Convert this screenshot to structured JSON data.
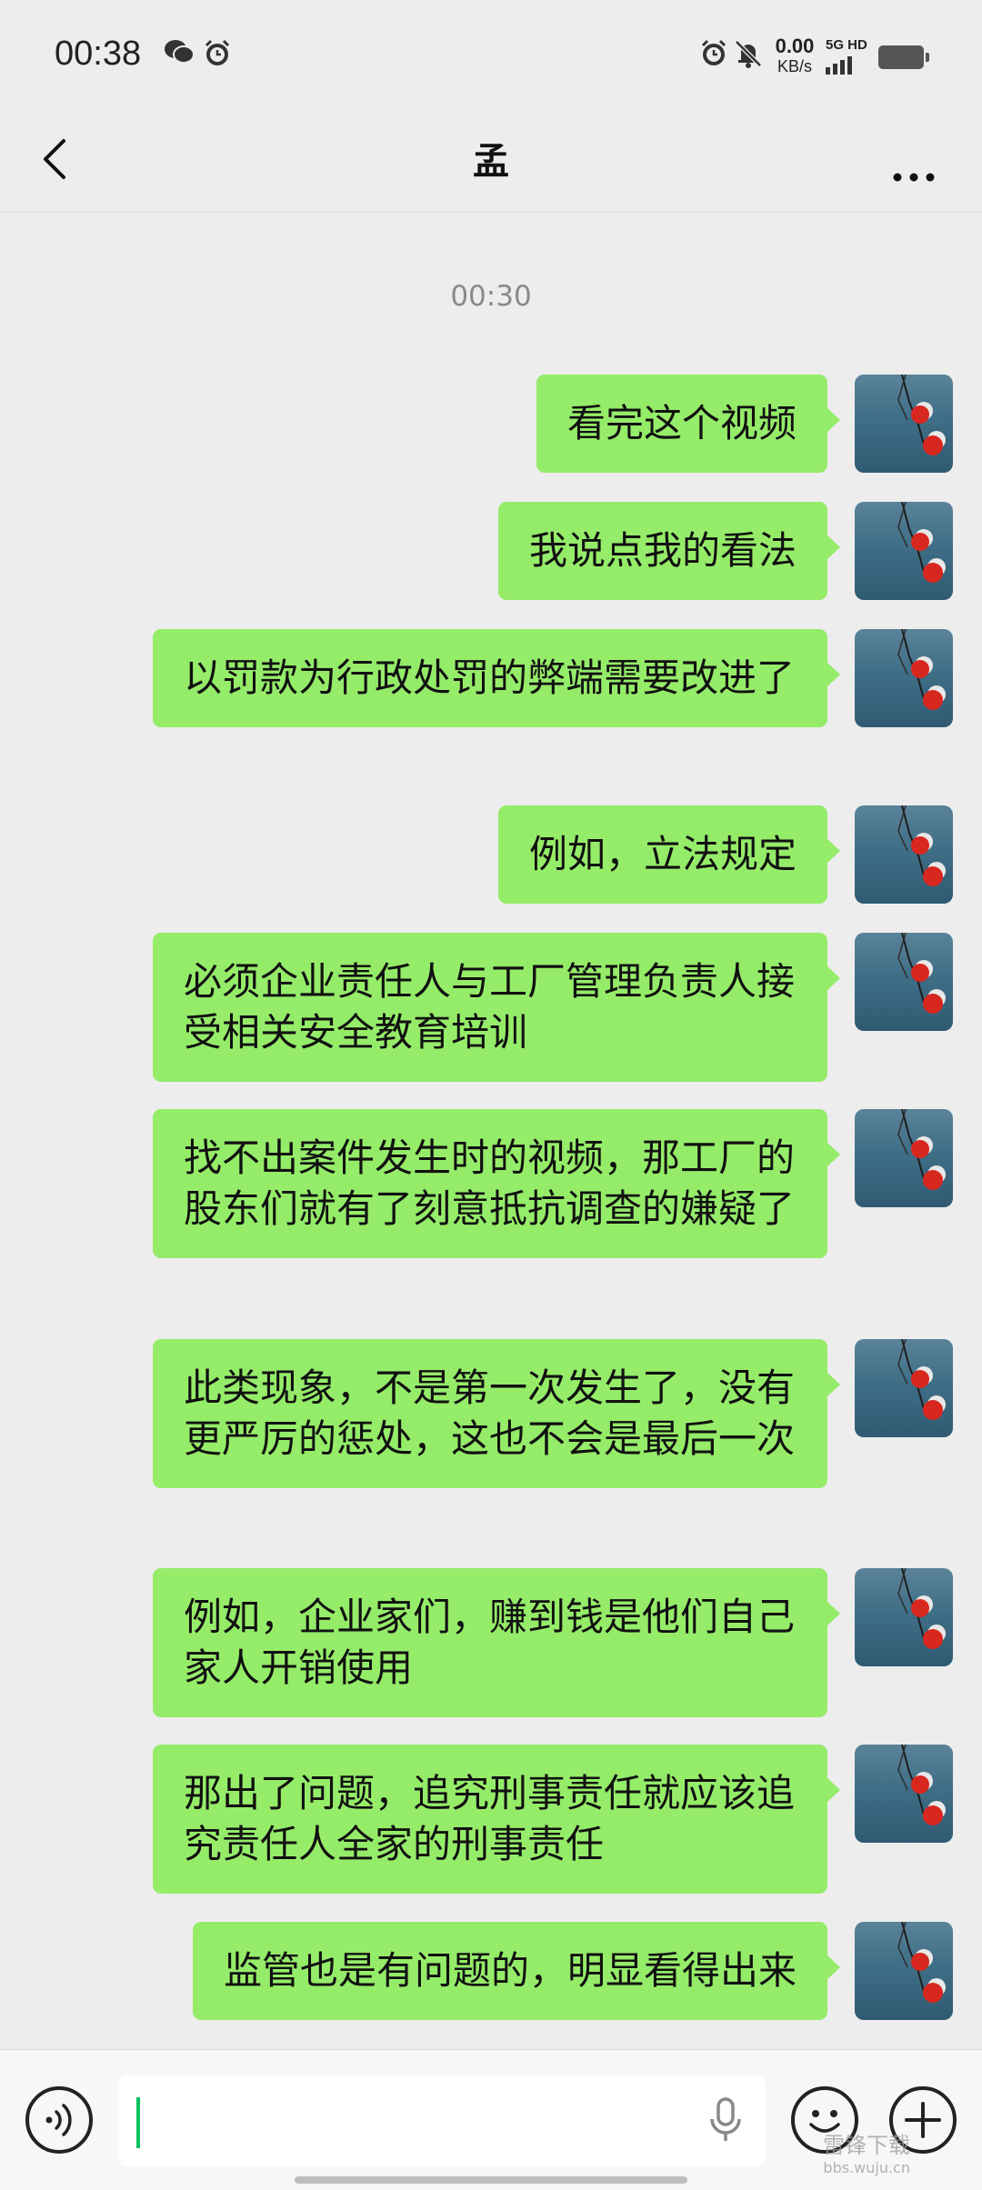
{
  "status_bar": {
    "time": "00:38",
    "net_speed_value": "0.00",
    "net_speed_unit": "KB/s",
    "network_type": "5G HD",
    "icons": [
      "wechat-icon",
      "alarm-icon",
      "alarm-icon",
      "mute-bell-icon",
      "signal-icon",
      "battery-icon"
    ]
  },
  "header": {
    "title": "孟",
    "back_icon": "chevron-left-icon",
    "more_icon": "more-dots-icon"
  },
  "conversation": {
    "timestamp": "00:30",
    "messages": [
      {
        "sender": "me",
        "text": "看完这个视频"
      },
      {
        "sender": "me",
        "text": "我说点我的看法"
      },
      {
        "sender": "me",
        "text": "以罚款为行政处罚的弊端需要改进了"
      },
      {
        "sender": "me",
        "text": "例如，立法规定"
      },
      {
        "sender": "me",
        "text": "必须企业责任人与工厂管理负责人接受相关安全教育培训"
      },
      {
        "sender": "me",
        "text": "找不出案件发生时的视频，那工厂的股东们就有了刻意抵抗调查的嫌疑了"
      },
      {
        "sender": "me",
        "text": "此类现象，不是第一次发生了，没有更严厉的惩处，这也不会是最后一次"
      },
      {
        "sender": "me",
        "text": "例如，企业家们，赚到钱是他们自己家人开销使用"
      },
      {
        "sender": "me",
        "text": "那出了问题，追究刑事责任就应该追究责任人全家的刑事责任"
      },
      {
        "sender": "me",
        "text": "监管也是有问题的，明显看得出来"
      }
    ]
  },
  "input_bar": {
    "voice_icon": "voice-mode-icon",
    "mic_icon": "microphone-icon",
    "emoji_icon": "emoji-icon",
    "plus_icon": "plus-icon"
  },
  "watermark": {
    "line1": "雷锋下载",
    "line2": "bbs.wuju.cn"
  },
  "colors": {
    "bubble_green": "#95ec69",
    "background": "#ededed",
    "caret": "#07c160"
  }
}
